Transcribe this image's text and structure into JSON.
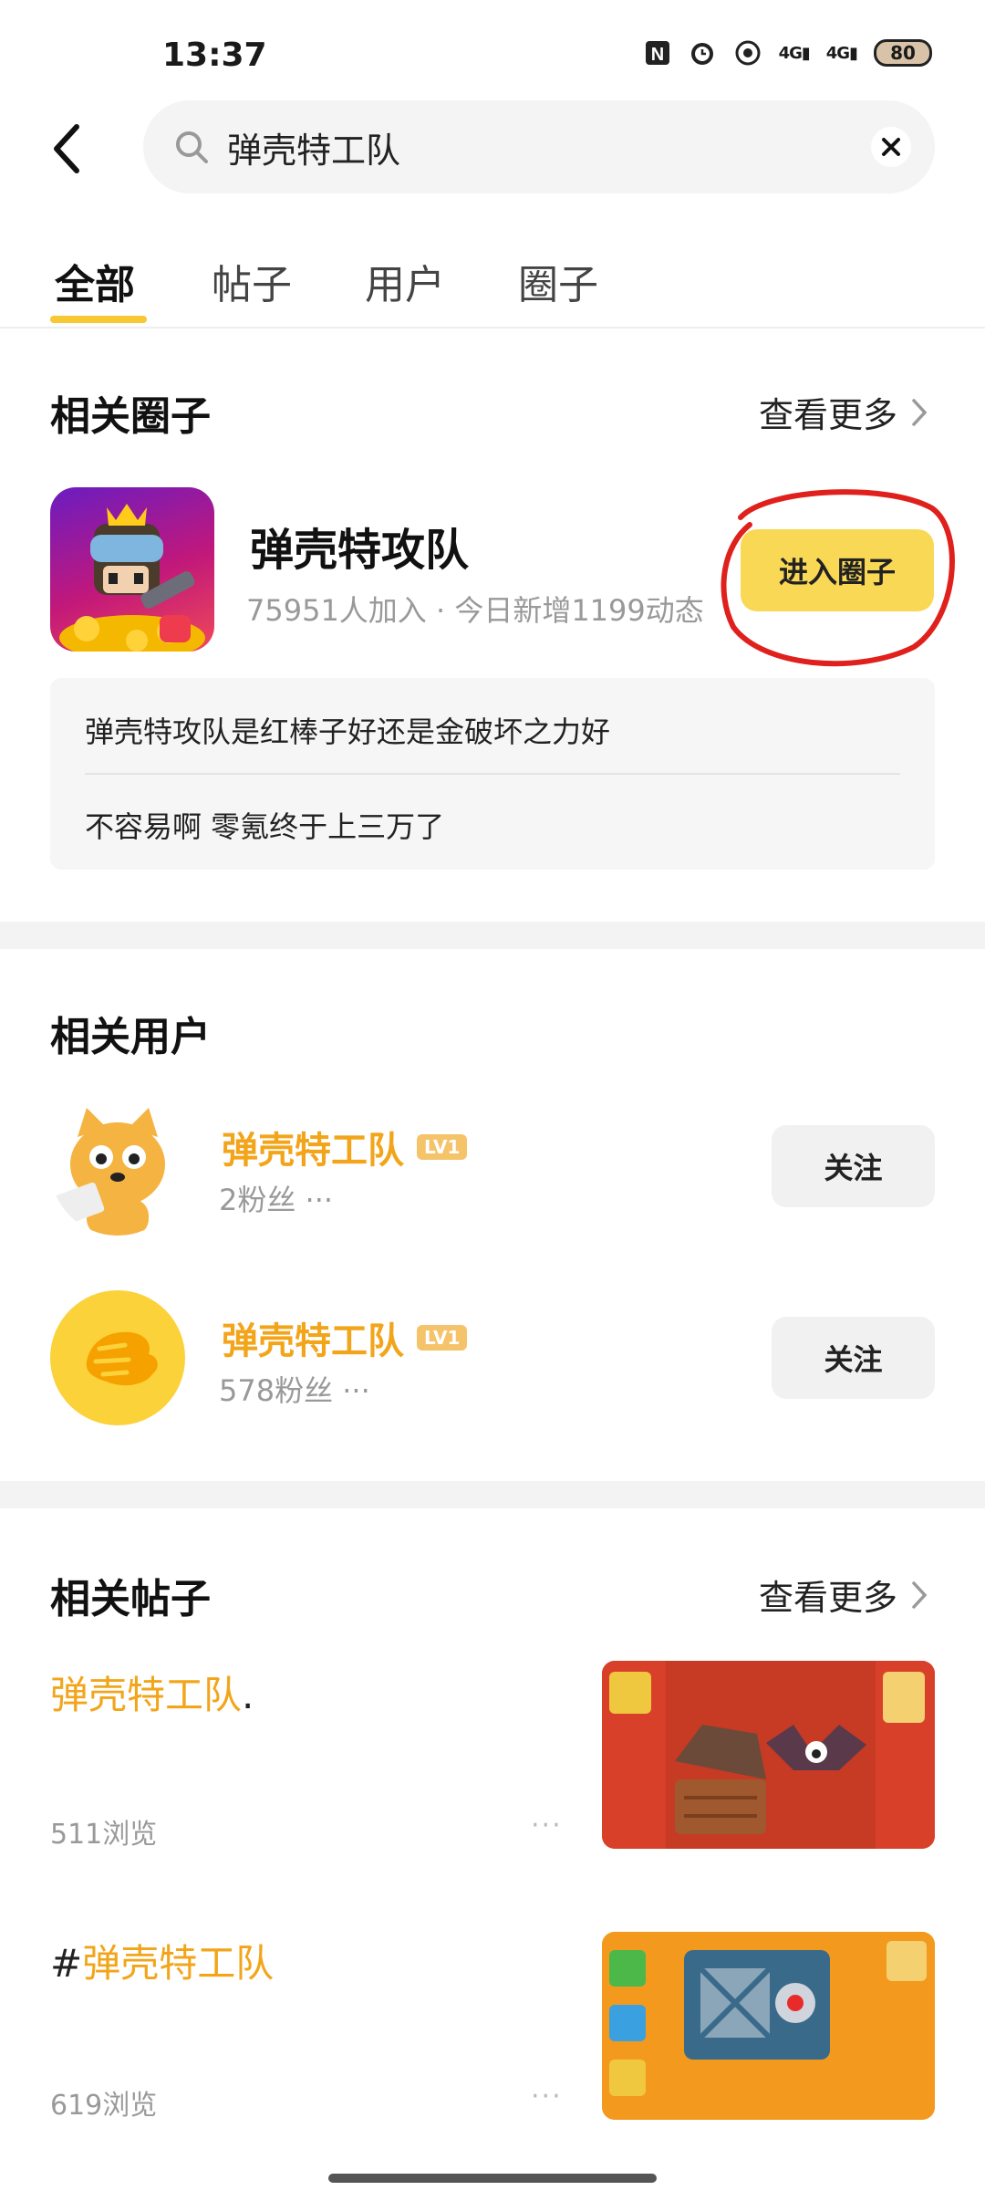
{
  "status_bar": {
    "time": "13:37",
    "battery": "80",
    "signal_1": "4G",
    "signal_2": "4G",
    "icons": [
      "nfc-icon",
      "alarm-icon",
      "data-saver-icon",
      "signal-icon",
      "signal-icon",
      "battery-icon"
    ]
  },
  "search": {
    "query": "弹壳特工队"
  },
  "tabs": [
    "全部",
    "帖子",
    "用户",
    "圈子"
  ],
  "circles_section": {
    "title": "相关圈子",
    "more_label": "查看更多",
    "circle": {
      "name": "弹壳特攻队",
      "stats": "75951人加入 · 今日新增1199动态",
      "enter_label": "进入圈子"
    },
    "hot_posts": [
      "弹壳特攻队是红棒子好还是金破坏之力好",
      "不容易啊 零氪终于上三万了"
    ]
  },
  "users_section": {
    "title": "相关用户",
    "users": [
      {
        "name": "弹壳特工队",
        "level": "LV1",
        "fans": "2粉丝 ···",
        "follow_label": "关注"
      },
      {
        "name": "弹壳特工队",
        "level": "LV1",
        "fans": "578粉丝 ···",
        "follow_label": "关注"
      }
    ]
  },
  "posts_section": {
    "title": "相关帖子",
    "more_label": "查看更多",
    "posts": [
      {
        "title_main": "弹壳特工队",
        "title_suffix": ".",
        "views": "511浏览",
        "dots": "···"
      },
      {
        "title_prefix": "#",
        "title_main": "弹壳特工队",
        "views": "619浏览",
        "dots": "···"
      }
    ]
  },
  "colors": {
    "accent_yellow": "#f9d855",
    "username_orange": "#f2a51a",
    "annotation_red": "#e0201c",
    "tab_underline": "#f7c832"
  }
}
